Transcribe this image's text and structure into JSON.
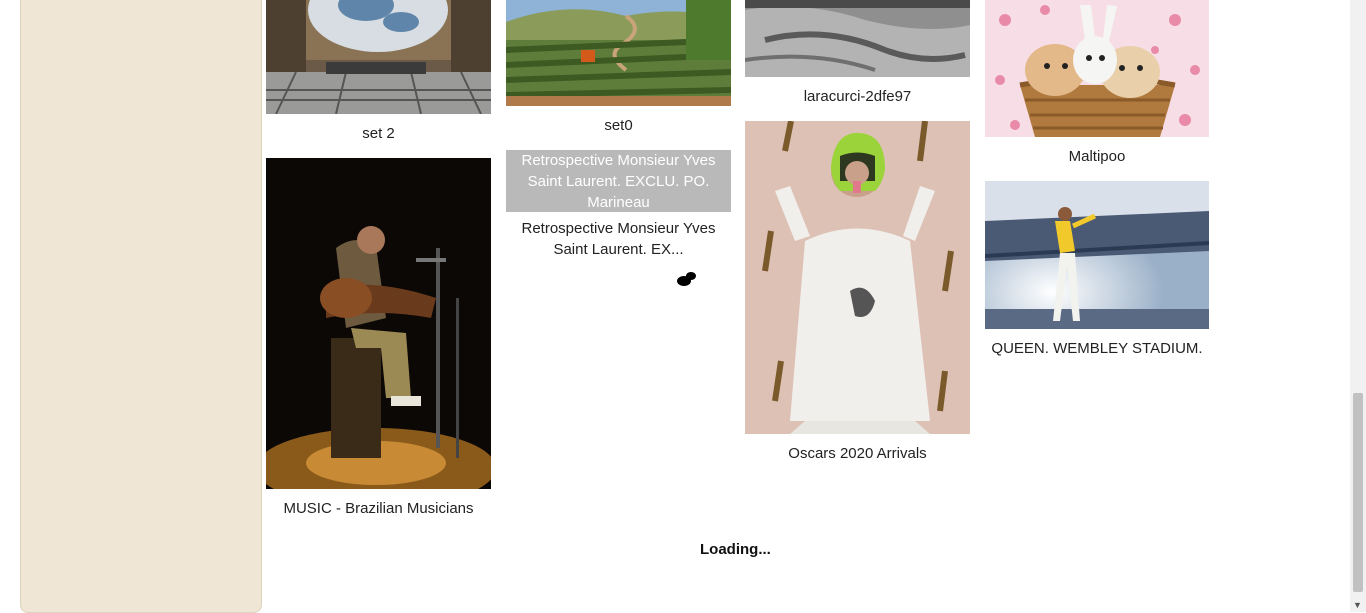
{
  "gallery": {
    "items": [
      {
        "caption": "set 2"
      },
      {
        "caption": "MUSIC - Brazilian Musicians"
      },
      {
        "caption": "set0"
      },
      {
        "alt_text": "Retrospective Monsieur Yves Saint Laurent. EXCLU. PO. Marineau",
        "caption": "Retrospective Monsieur Yves Saint Laurent. EX..."
      },
      {
        "caption": "laracurci-2dfe97"
      },
      {
        "caption": "Oscars 2020 Arrivals"
      },
      {
        "caption": "Maltipoo"
      },
      {
        "caption": "QUEEN. WEMBLEY STADIUM."
      }
    ],
    "loading_text": "Loading..."
  }
}
